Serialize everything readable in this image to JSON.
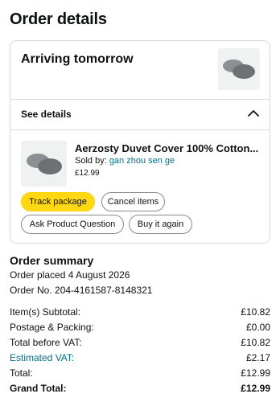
{
  "page": {
    "title": "Order details"
  },
  "shipment": {
    "status": "Arriving tomorrow",
    "see_details_label": "See details",
    "item": {
      "title": "Aerzosty Duvet Cover 100% Cotton...",
      "sold_by_prefix": "Sold by:",
      "seller": "gan zhou sen ge",
      "price": "£12.99"
    },
    "buttons": {
      "track": "Track package",
      "cancel": "Cancel items",
      "question": "Ask Product Question",
      "buy_again": "Buy it again"
    }
  },
  "summary": {
    "title": "Order summary",
    "placed": "Order placed 4 August 2026",
    "order_no": "Order No. 204-4161587-8148321",
    "rows": [
      {
        "label": "Item(s) Subtotal:",
        "value": "£10.82"
      },
      {
        "label": "Postage & Packing:",
        "value": "£0.00"
      },
      {
        "label": "Total before VAT:",
        "value": "£10.82"
      },
      {
        "label": "Estimated VAT:",
        "value": "£2.17"
      },
      {
        "label": "Total:",
        "value": "£12.99"
      },
      {
        "label": "Grand Total:",
        "value": "£12.99"
      }
    ]
  },
  "colors": {
    "accent_yellow": "#ffd814",
    "link": "#007185",
    "border": "#d5d9d9"
  },
  "icons": {
    "collapse": "chevron-up-icon",
    "product": "pillow-product-image"
  }
}
